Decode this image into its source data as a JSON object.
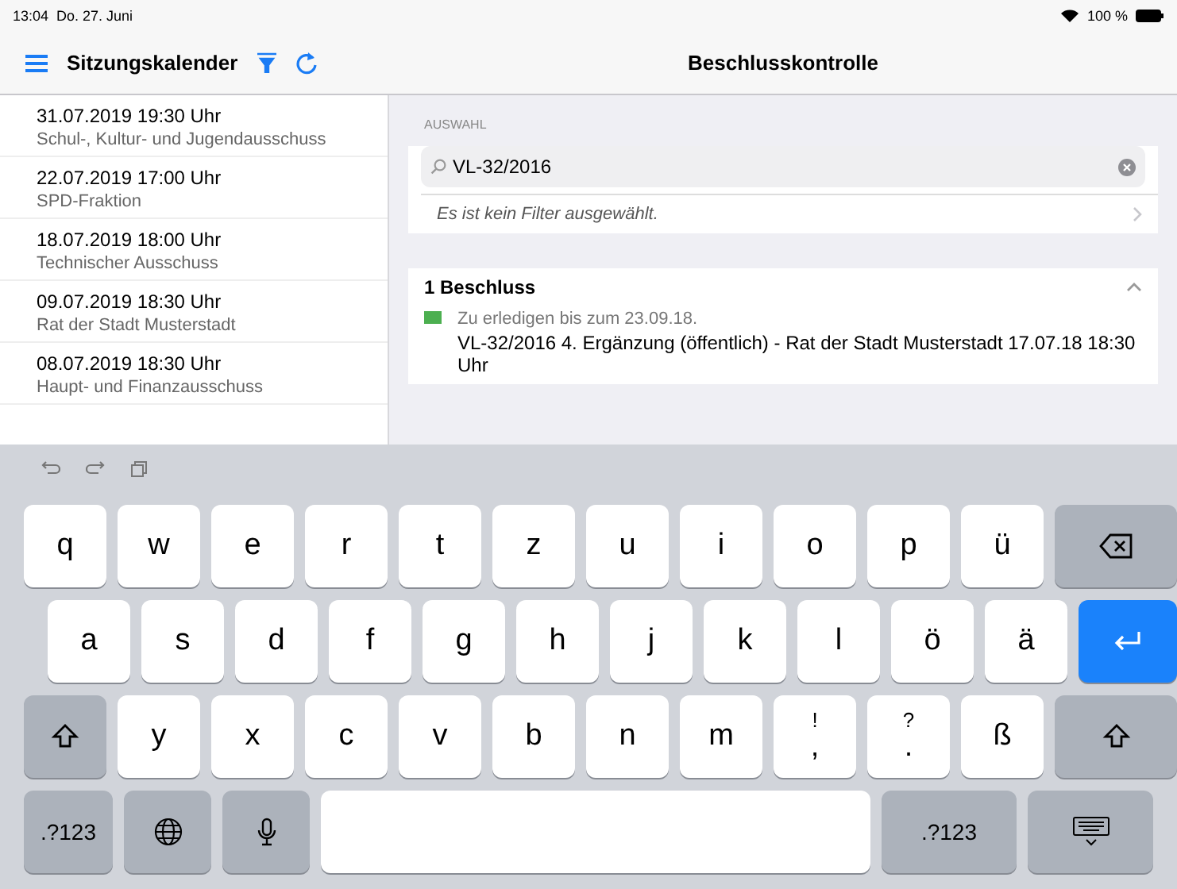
{
  "status_bar": {
    "time": "13:04",
    "date": "Do. 27. Juni",
    "battery": "100 %"
  },
  "sidebar": {
    "title": "Sitzungskalender",
    "meetings": [
      {
        "date": "31.07.2019 19:30 Uhr",
        "name": "Schul-, Kultur- und Jugendausschuss"
      },
      {
        "date": "22.07.2019 17:00 Uhr",
        "name": "SPD-Fraktion"
      },
      {
        "date": "18.07.2019 18:00 Uhr",
        "name": "Technischer Ausschuss"
      },
      {
        "date": "09.07.2019 18:30 Uhr",
        "name": "Rat der Stadt Musterstadt"
      },
      {
        "date": "08.07.2019 18:30 Uhr",
        "name": "Haupt- und Finanzausschuss"
      }
    ]
  },
  "detail": {
    "title": "Beschlusskontrolle",
    "section_label": "AUSWAHL",
    "search": {
      "value": "VL-32/2016"
    },
    "filter_text": "Es ist kein Filter ausgewählt.",
    "results": {
      "heading": "1 Beschluss",
      "expanded": true,
      "items": [
        {
          "due": "Zu erledigen bis zum 23.09.18.",
          "color": "#4caf50",
          "title": "VL-32/2016 4. Ergänzung (öffentlich) - Rat der Stadt Musterstadt 17.07.18 18:30 Uhr"
        }
      ]
    }
  },
  "keyboard": {
    "rows": [
      [
        {
          "kind": "letter",
          "label": "q"
        },
        {
          "kind": "letter",
          "label": "w"
        },
        {
          "kind": "letter",
          "label": "e"
        },
        {
          "kind": "letter",
          "label": "r"
        },
        {
          "kind": "letter",
          "label": "t"
        },
        {
          "kind": "letter",
          "label": "z"
        },
        {
          "kind": "letter",
          "label": "u"
        },
        {
          "kind": "letter",
          "label": "i"
        },
        {
          "kind": "letter",
          "label": "o"
        },
        {
          "kind": "letter",
          "label": "p"
        },
        {
          "kind": "letter",
          "label": "ü"
        },
        {
          "kind": "backspace"
        }
      ],
      [
        {
          "kind": "letter",
          "label": "a"
        },
        {
          "kind": "letter",
          "label": "s"
        },
        {
          "kind": "letter",
          "label": "d"
        },
        {
          "kind": "letter",
          "label": "f"
        },
        {
          "kind": "letter",
          "label": "g"
        },
        {
          "kind": "letter",
          "label": "h"
        },
        {
          "kind": "letter",
          "label": "j"
        },
        {
          "kind": "letter",
          "label": "k"
        },
        {
          "kind": "letter",
          "label": "l"
        },
        {
          "kind": "letter",
          "label": "ö"
        },
        {
          "kind": "letter",
          "label": "ä"
        },
        {
          "kind": "return"
        }
      ],
      [
        {
          "kind": "shift"
        },
        {
          "kind": "letter",
          "label": "y"
        },
        {
          "kind": "letter",
          "label": "x"
        },
        {
          "kind": "letter",
          "label": "c"
        },
        {
          "kind": "letter",
          "label": "v"
        },
        {
          "kind": "letter",
          "label": "b"
        },
        {
          "kind": "letter",
          "label": "n"
        },
        {
          "kind": "letter",
          "label": "m"
        },
        {
          "kind": "letter",
          "label": ",",
          "alt": "!"
        },
        {
          "kind": "letter",
          "label": ".",
          "alt": "?"
        },
        {
          "kind": "letter",
          "label": "ß"
        },
        {
          "kind": "shift"
        }
      ],
      [
        {
          "kind": "mode",
          "label": ".?123"
        },
        {
          "kind": "globe"
        },
        {
          "kind": "mic"
        },
        {
          "kind": "space"
        },
        {
          "kind": "mode",
          "label": ".?123"
        },
        {
          "kind": "hide"
        }
      ]
    ]
  }
}
